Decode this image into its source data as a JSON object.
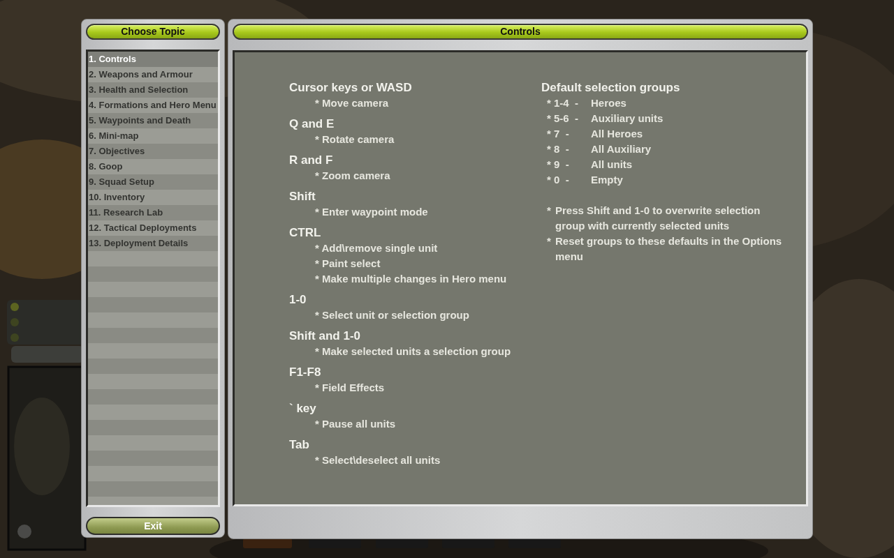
{
  "topic_panel": {
    "title": "Choose Topic",
    "topics": [
      {
        "label": "1. Controls",
        "selected": true
      },
      {
        "label": "2. Weapons and Armour",
        "selected": false
      },
      {
        "label": "3. Health and Selection",
        "selected": false
      },
      {
        "label": "4. Formations and Hero Menu",
        "selected": false
      },
      {
        "label": "5. Waypoints and Death",
        "selected": false
      },
      {
        "label": "6. Mini-map",
        "selected": false
      },
      {
        "label": "7. Objectives",
        "selected": false
      },
      {
        "label": "8. Goop",
        "selected": false
      },
      {
        "label": "9. Squad Setup",
        "selected": false
      },
      {
        "label": "10. Inventory",
        "selected": false
      },
      {
        "label": "11. Research Lab",
        "selected": false
      },
      {
        "label": "12. Tactical Deployments",
        "selected": false
      },
      {
        "label": "13. Deployment Details",
        "selected": false
      }
    ],
    "exit_button": "Exit"
  },
  "content_panel": {
    "title": "Controls",
    "sections": [
      {
        "key": "Cursor keys or WASD",
        "actions": [
          "* Move camera"
        ]
      },
      {
        "key": "Q and E",
        "actions": [
          "* Rotate camera"
        ]
      },
      {
        "key": "R and F",
        "actions": [
          "* Zoom camera"
        ]
      },
      {
        "key": "Shift",
        "actions": [
          "* Enter waypoint mode"
        ]
      },
      {
        "key": "CTRL",
        "actions": [
          "* Add\\remove single unit",
          "* Paint select",
          "* Make multiple changes in Hero menu"
        ]
      },
      {
        "key": "1-0",
        "actions": [
          "* Select unit or selection group"
        ]
      },
      {
        "key": "Shift and 1-0",
        "actions": [
          "* Make selected units a selection group"
        ]
      },
      {
        "key": "F1-F8",
        "actions": [
          "* Field Effects"
        ]
      },
      {
        "key": "` key",
        "actions": [
          "* Pause all units"
        ]
      },
      {
        "key": "Tab",
        "actions": [
          "* Select\\deselect all units"
        ]
      }
    ],
    "groups_title": "Default selection groups",
    "groups": [
      {
        "keys": "* 1-4  -",
        "desc": "Heroes"
      },
      {
        "keys": "* 5-6  -",
        "desc": "Auxiliary units"
      },
      {
        "keys": "* 7  -",
        "desc": "All Heroes"
      },
      {
        "keys": "* 8  -",
        "desc": "All Auxiliary"
      },
      {
        "keys": "* 9  -",
        "desc": "All units"
      },
      {
        "keys": "* 0  -",
        "desc": "Empty"
      }
    ],
    "notes": [
      {
        "bullet": "*",
        "text": "Press Shift and 1-0 to overwrite selection group with currently selected units"
      },
      {
        "bullet": "*",
        "text": "Reset groups to these defaults in the Options menu"
      }
    ]
  }
}
